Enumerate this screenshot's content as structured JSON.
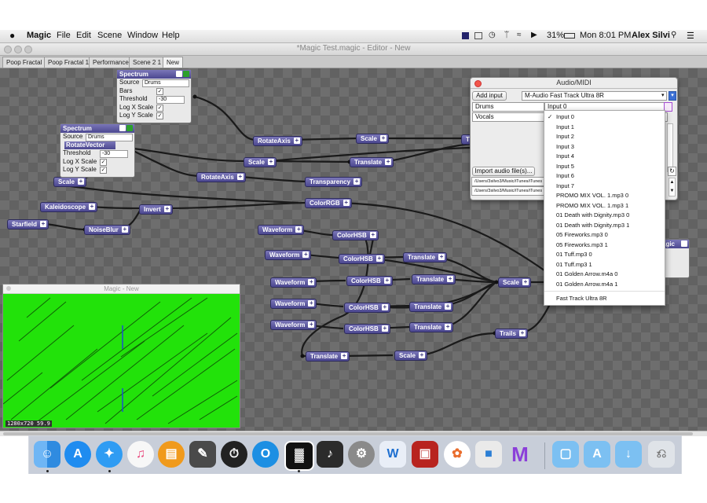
{
  "menubar": {
    "apple": "",
    "app_name": "Magic",
    "items": [
      "File",
      "Edit",
      "Scene",
      "Window",
      "Help"
    ],
    "battery": "31%",
    "clock": "Mon 8:01 PM",
    "user": "Alex Silvi"
  },
  "window": {
    "title": "*Magic Test.magic - Editor - New"
  },
  "tabs": [
    "Poop Fractal",
    "Poop Fractal 1",
    "Performance",
    "Scene 2 1",
    "New"
  ],
  "active_tab": "New",
  "panels": {
    "spectrum1": {
      "title": "Spectrum",
      "source_label": "Source",
      "source_value": "Drums",
      "bars_label": "Bars",
      "bars_checked": true,
      "threshold_label": "Threshold",
      "threshold_value": "-30",
      "logx_label": "Log X Scale",
      "logx_checked": true,
      "logy_label": "Log Y Scale",
      "logy_checked": true
    },
    "spectrum2": {
      "title": "Spectrum",
      "source_label": "Source",
      "source_value": "Drums",
      "rotate_label": "RotateVector",
      "threshold_label": "Threshold",
      "threshold_value": "-30",
      "logx_label": "Log X Scale",
      "logx_checked": true,
      "logy_label": "Log Y Scale",
      "logy_checked": true
    }
  },
  "nodes": {
    "rotateaxis_1": "RotateAxis",
    "scale_1": "Scale",
    "tr_partial": "Tr",
    "scale_2": "Scale",
    "translate_1": "Translate",
    "rotateaxis_2": "RotateAxis",
    "transparency": "Transparency",
    "scale_3": "Scale",
    "kaleidoscope": "Kaleidoscope",
    "invert": "Invert",
    "colorrgb": "ColorRGB",
    "starfield": "Starfield",
    "noiseblur": "NoiseBlur",
    "waveform_1": "Waveform",
    "colorhsb_1": "ColorHSB",
    "waveform_2": "Waveform",
    "colorhsb_2": "ColorHSB",
    "translate_2": "Translate",
    "waveform_3": "Waveform",
    "colorhsb_3": "ColorHSB",
    "translate_3": "Translate",
    "scale_4": "Scale",
    "waveform_4": "Waveform",
    "colorhsb_4": "ColorHSB",
    "translate_4": "Translate",
    "waveform_5": "Waveform",
    "colorhsb_5": "ColorHSB",
    "translate_5": "Translate",
    "trails": "Trails",
    "translate_6": "Translate",
    "scale_5": "Scale",
    "magic_partial": "agic"
  },
  "preview": {
    "title": "Magic - New",
    "status": "1280x720 59.9"
  },
  "audio_midi": {
    "title": "Audio/MIDI",
    "add_input_label": "Add input",
    "device_value": "M-Audio Fast Track Ultra 8R",
    "inputs": [
      {
        "name": "Drums",
        "channel": "Input 0"
      },
      {
        "name": "Vocals",
        "channel": ""
      }
    ],
    "import_label": "Import audio file(s)...",
    "paths": [
      "/Users/3silvo3/Music/iTunes/iTunes M",
      "/Users/3silvo3/Music/iTunes/iTunes M"
    ]
  },
  "dropdown": {
    "selected": "Input 0",
    "options": [
      "Input 0",
      "Input 1",
      "Input 2",
      "Input 3",
      "Input 4",
      "Input 5",
      "Input 6",
      "Input 7",
      "PROMO MIX VOL. 1.mp3 0",
      "PROMO MIX VOL. 1.mp3 1",
      "01 Death with Dignity.mp3 0",
      "01 Death with Dignity.mp3 1",
      "05 Fireworks.mp3 0",
      "05 Fireworks.mp3 1",
      "01 Tuff.mp3 0",
      "01 Tuff.mp3 1",
      "01 Golden Arrow.m4a 0",
      "01 Golden Arrow.m4a 1",
      "Fast Track Ultra 8R"
    ]
  },
  "dock": {
    "apps": [
      "finder-icon",
      "app-store-icon",
      "safari-icon",
      "itunes-icon",
      "ibooks-icon",
      "final-cut-icon",
      "dashboard-icon",
      "quicktime-icon",
      "magic-icon",
      "logic-icon",
      "system-preferences-icon",
      "word-icon",
      "photo-booth-icon",
      "photos-icon",
      "preview-icon",
      "magic-m-icon",
      "folder-icon",
      "applications-folder-icon",
      "downloads-folder-icon",
      "trash-icon"
    ]
  },
  "colors": {
    "node": "#4c4890",
    "accent": "#7a76b8",
    "preview_bg": "#22e20a",
    "canvas": "#6e6e6e"
  }
}
